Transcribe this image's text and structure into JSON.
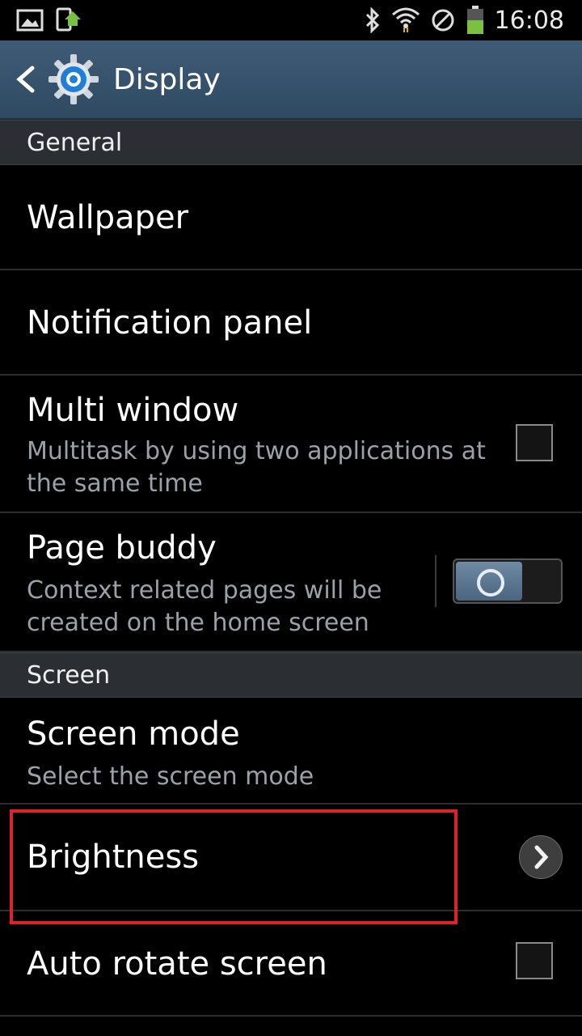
{
  "status_bar": {
    "time": "16:08",
    "icons": [
      "gallery-icon",
      "update-icon",
      "bluetooth-icon",
      "wifi-icon",
      "blocking-mode-icon",
      "battery-icon"
    ]
  },
  "action_bar": {
    "title": "Display",
    "icons": [
      "back-icon",
      "settings-gear-icon"
    ]
  },
  "sections": [
    {
      "header": "General"
    },
    {
      "header": "Screen"
    }
  ],
  "items": {
    "wallpaper": {
      "title": "Wallpaper"
    },
    "notification_panel": {
      "title": "Notification panel"
    },
    "multi_window": {
      "title": "Multi window",
      "subtitle": "Multitask by using two applications at the same time",
      "subtitle_line1": "Multitask by using two applications at",
      "subtitle_line2": "the same time",
      "checked": false
    },
    "page_buddy": {
      "title": "Page buddy",
      "subtitle_line1": "Context related pages will be",
      "subtitle_line2": "created on the home screen",
      "enabled": false
    },
    "screen_mode": {
      "title": "Screen mode",
      "subtitle": "Select the screen mode"
    },
    "brightness": {
      "title": "Brightness"
    },
    "auto_rotate": {
      "title": "Auto rotate screen",
      "checked": false
    }
  },
  "colors": {
    "action_bar": "#365370",
    "section_bg": "#2b2f33",
    "subtitle_text": "#9aa1a8",
    "highlight": "#e0202a",
    "battery_fill": "#7ac143"
  }
}
